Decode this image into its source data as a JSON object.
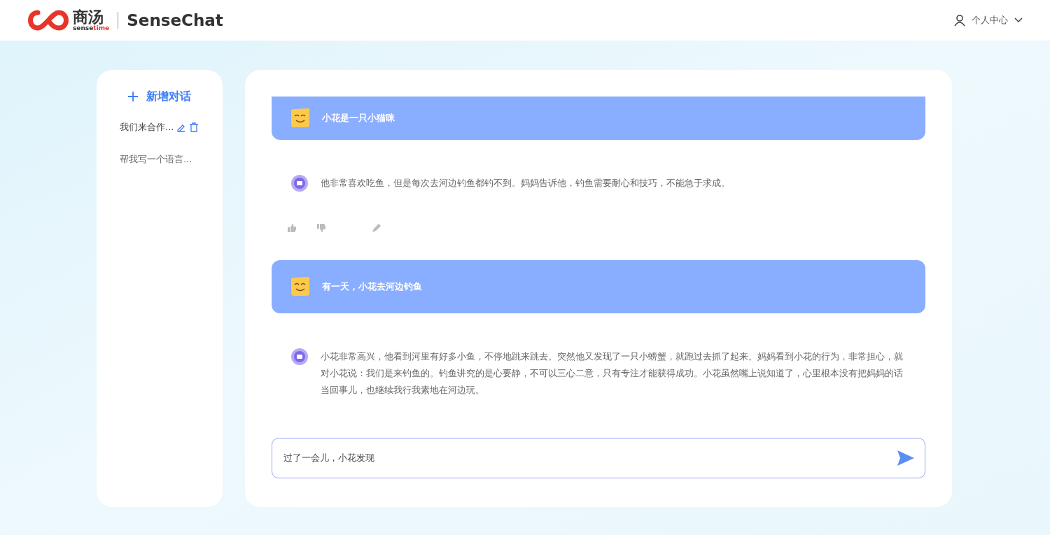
{
  "header": {
    "logo_cn": "商汤",
    "logo_en_a": "sense",
    "logo_en_b": "time",
    "product": "SenseChat",
    "user_menu": "个人中心"
  },
  "sidebar": {
    "new_chat": "新增对话",
    "items": [
      {
        "label": "我们来合作...",
        "selected": true
      },
      {
        "label": "帮我写一个语言...",
        "selected": false
      }
    ]
  },
  "messages": [
    {
      "kind": "user",
      "text": "小花是一只小猫咪"
    },
    {
      "kind": "bot",
      "text": "他非常喜欢吃鱼，但是每次去河边钓鱼都钓不到。妈妈告诉他，钓鱼需要耐心和技巧，不能急于求成。"
    },
    {
      "kind": "reactions"
    },
    {
      "kind": "user",
      "text": "有一天，小花去河边钓鱼"
    },
    {
      "kind": "bot",
      "text": "小花非常高兴，他看到河里有好多小鱼，不停地跳来跳去。突然他又发现了一只小螃蟹，就跑过去抓了起来。妈妈看到小花的行为，非常担心，就对小花说：我们是来钓鱼的。钓鱼讲究的是心要静，不可以三心二意，只有专注才能获得成功。小花虽然嘴上说知道了，心里根本没有把妈妈的话当回事儿，也继续我行我素地在河边玩。"
    }
  ],
  "input": {
    "value": "过了一会儿，小花发现"
  }
}
